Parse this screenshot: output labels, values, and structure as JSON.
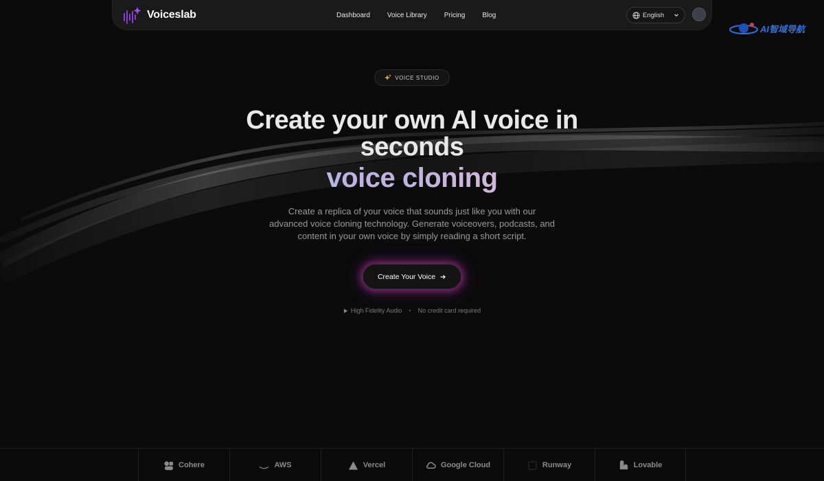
{
  "brand": {
    "name": "Voiceslab",
    "accent": "#8a3ad6"
  },
  "nav": {
    "links": [
      "Dashboard",
      "Voice Library",
      "Pricing",
      "Blog"
    ],
    "language": "English"
  },
  "watermark": {
    "text": "AI智域导航"
  },
  "hero": {
    "badge": "VOICE STUDIO",
    "title_line1": "Create your own AI voice in",
    "title_line2": "seconds",
    "title_highlight": "voice cloning",
    "description": "Create a replica of your voice that sounds just like you with our advanced voice cloning technology. Generate voiceovers, podcasts, and content in your own voice by simply reading a short script.",
    "cta_label": "Create Your Voice",
    "meta_left": "High Fidelity Audio",
    "meta_sep": "•",
    "meta_right": "No credit card required"
  },
  "partners": [
    {
      "name": "Cohere",
      "icon": "cohere-icon"
    },
    {
      "name": "AWS",
      "icon": "aws-icon"
    },
    {
      "name": "Vercel",
      "icon": "vercel-icon"
    },
    {
      "name": "Google Cloud",
      "icon": "google-cloud-icon"
    },
    {
      "name": "Runway",
      "icon": "runway-icon"
    },
    {
      "name": "Lovable",
      "icon": "lovable-icon"
    }
  ]
}
